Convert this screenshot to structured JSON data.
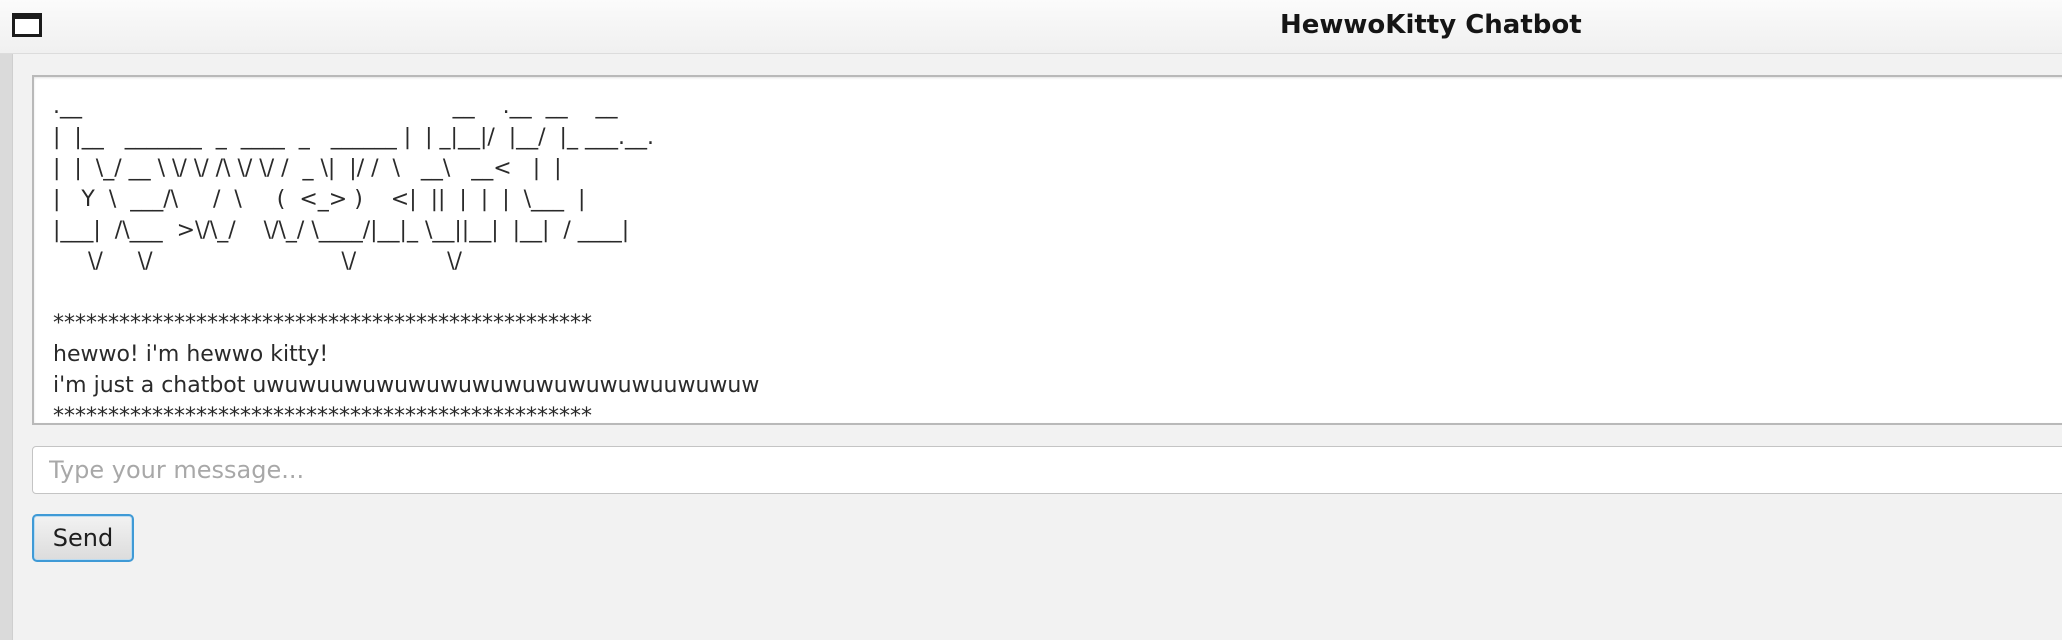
{
  "window": {
    "title": "HewwoKitty Chatbot",
    "icon": "window-icon"
  },
  "chat": {
    "transcript": ".__                                                     __    .__  __    __        \n|  |__   _______  _  ____  _   ______ |  | _|__|/  |__/  |_ ___.__.\n|  |  \\_/ __ \\ \\/ \\/ /\\ \\/ \\/ /  _ \\|  |/ /  \\   __\\   __<   |  |\n|   Y  \\  ___/\\     /  \\     (  <_> )    <|  ||  |  |  |  \\___  |\n|___|  /\\___  >\\/\\_/    \\/\\_/ \\____/|__|_ \\__||__|  |__|  / ____|\n     \\/     \\/                           \\/             \\/\n\n*************************************************\nhewwo! i'm hewwo kitty!\ni'm just a chatbot uwuwuuwuwuwuwuwuwuwuwuwuwuuwuwuw\n*************************************************"
  },
  "input": {
    "placeholder": "Type your message...",
    "value": ""
  },
  "send_button": {
    "label": "Send"
  },
  "colors": {
    "background": "#f2f2f2",
    "accent_focus": "#3f9ad6",
    "title_text": "#151515"
  }
}
